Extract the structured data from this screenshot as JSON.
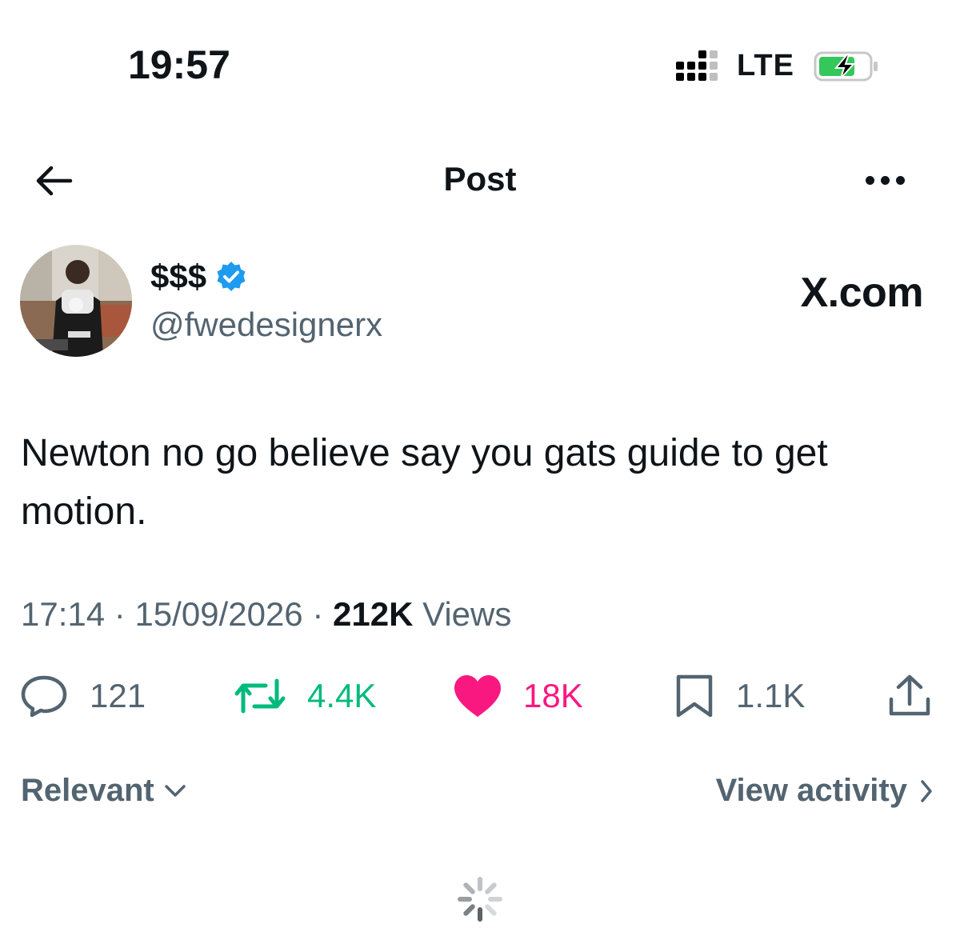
{
  "status_bar": {
    "time": "19:57",
    "network": "LTE",
    "signal_bars_filled": 3,
    "signal_bars_total": 4,
    "battery_charging": true,
    "battery_color": "#34c759"
  },
  "header": {
    "title": "Post",
    "back_icon": "back-arrow-icon",
    "more_icon": "more-horizontal-icon"
  },
  "author": {
    "display_name": "$$$",
    "handle": "@fwedesignerx",
    "verified": true,
    "verified_color": "#1d9bf0"
  },
  "watermark": "X.com",
  "tweet": {
    "text": "Newton no go believe say you gats guide to get motion."
  },
  "meta": {
    "time": "17:14",
    "separator": "·",
    "date": "15/09/2026",
    "views_count": "212K",
    "views_label": "Views"
  },
  "actions": {
    "replies": "121",
    "reposts": "4.4K",
    "likes": "18K",
    "bookmarks": "1.1K"
  },
  "colors": {
    "text_primary": "#0f1419",
    "text_secondary": "#536471",
    "repost_green": "#00ba7c",
    "like_pink": "#f91880"
  },
  "sort": {
    "label": "Relevant",
    "view_activity": "View activity"
  }
}
